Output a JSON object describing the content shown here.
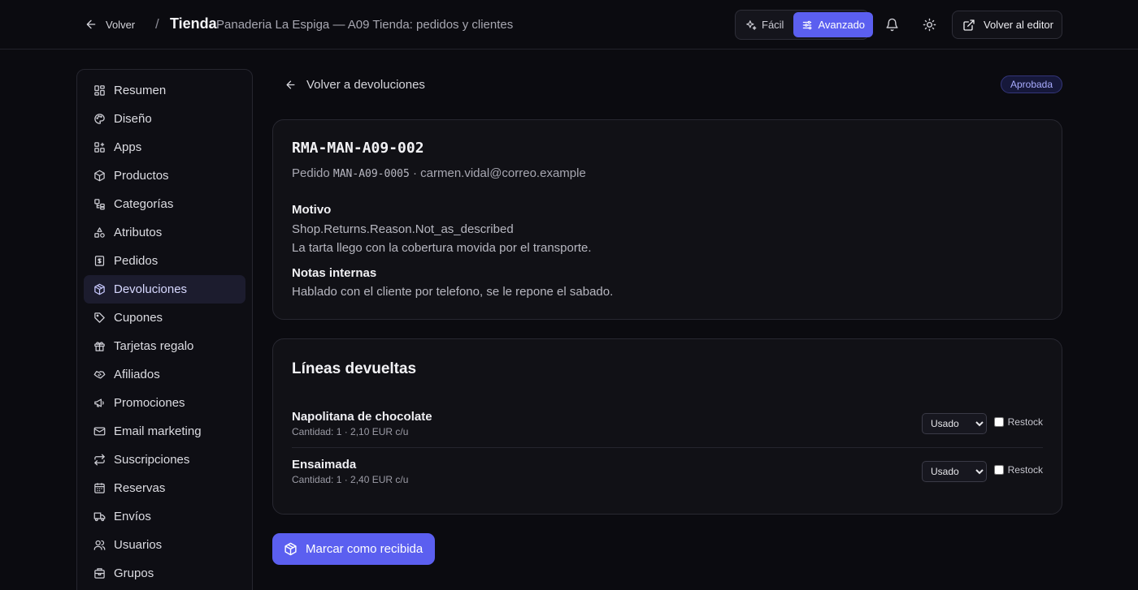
{
  "header": {
    "back_label": "Volver",
    "separator": "/",
    "title": "Tienda",
    "subtitle": "Panaderia La Espiga — A09 Tienda: pedidos y clientes",
    "mode_easy": "Fácil",
    "mode_advanced": "Avanzado",
    "active_mode": "advanced",
    "editor_label": "Volver al editor"
  },
  "sidebar": {
    "items": [
      {
        "label": "Resumen",
        "icon": "dashboard-icon"
      },
      {
        "label": "Diseño",
        "icon": "palette-icon"
      },
      {
        "label": "Apps",
        "icon": "apps-icon"
      },
      {
        "label": "Productos",
        "icon": "package-icon"
      },
      {
        "label": "Categorías",
        "icon": "categories-icon"
      },
      {
        "label": "Atributos",
        "icon": "shapes-icon"
      },
      {
        "label": "Pedidos",
        "icon": "receipt-icon"
      },
      {
        "label": "Devoluciones",
        "icon": "package-return-icon"
      },
      {
        "label": "Cupones",
        "icon": "tag-icon"
      },
      {
        "label": "Tarjetas regalo",
        "icon": "gift-icon"
      },
      {
        "label": "Afiliados",
        "icon": "handshake-icon"
      },
      {
        "label": "Promociones",
        "icon": "megaphone-icon"
      },
      {
        "label": "Email marketing",
        "icon": "mail-icon"
      },
      {
        "label": "Suscripciones",
        "icon": "repeat-icon"
      },
      {
        "label": "Reservas",
        "icon": "calendar-icon"
      },
      {
        "label": "Envíos",
        "icon": "truck-icon"
      },
      {
        "label": "Usuarios",
        "icon": "users-icon"
      },
      {
        "label": "Grupos",
        "icon": "building-icon"
      }
    ],
    "active_index": 7
  },
  "main": {
    "back_label": "Volver a devoluciones",
    "status": "Aprobada",
    "status_color": "#a9acff",
    "rma": "RMA-MAN-A09-002",
    "order_prefix": "Pedido",
    "order_number": "MAN-A09-0005",
    "order_sep": "·",
    "email": "carmen.vidal@correo.example",
    "reason_title": "Motivo",
    "reason_key": "Shop.Returns.Reason.Not_as_described",
    "reason_text": "La tarta llego con la cobertura movida por el transporte.",
    "notes_title": "Notas internas",
    "notes_text": "Hablado con el cliente por telefono, se le repone el sabado.",
    "lines_title": "Líneas devueltas",
    "lines": [
      {
        "name": "Napolitana de chocolate",
        "meta": "Cantidad: 1 · 2,10 EUR c/u",
        "condition": "Usado",
        "restock_label": "Restock",
        "restock": false
      },
      {
        "name": "Ensaimada",
        "meta": "Cantidad: 1 · 2,40 EUR c/u",
        "condition": "Usado",
        "restock_label": "Restock",
        "restock": false
      }
    ],
    "primary_action": "Marcar como recibida"
  },
  "colors": {
    "accent": "#5b5ff0",
    "background": "#0b0b10",
    "card": "#111116"
  }
}
